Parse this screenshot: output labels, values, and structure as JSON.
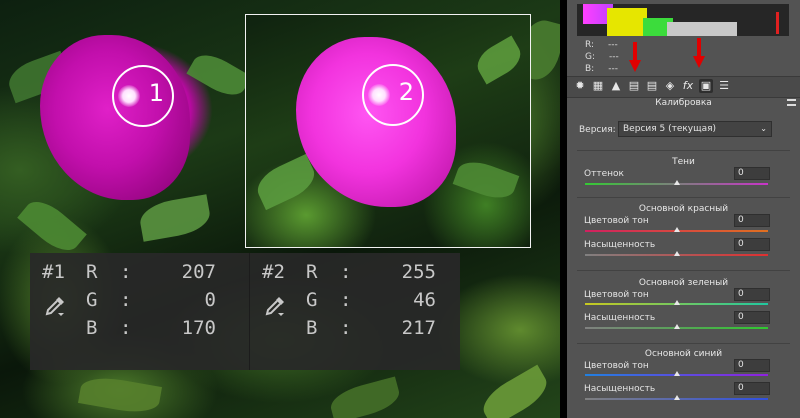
{
  "samples": [
    {
      "id": "#1",
      "channels": [
        {
          "ch": "R",
          "val": "207"
        },
        {
          "ch": "G",
          "val": "0"
        },
        {
          "ch": "B",
          "val": "170"
        }
      ]
    },
    {
      "id": "#2",
      "channels": [
        {
          "ch": "R",
          "val": "255"
        },
        {
          "ch": "G",
          "val": "46"
        },
        {
          "ch": "B",
          "val": "217"
        }
      ]
    }
  ],
  "markers": [
    "1",
    "2"
  ],
  "colon": ":",
  "panel": {
    "readout": [
      {
        "ch": "R:",
        "val": "---"
      },
      {
        "ch": "G:",
        "val": "---"
      },
      {
        "ch": "B:",
        "val": "---"
      }
    ],
    "tools": [
      "aperture-icon",
      "grid-icon",
      "triangle-icon",
      "split-icon",
      "tone-icon",
      "lens-icon",
      "fx",
      "calibration-icon",
      "presets-icon"
    ],
    "tool_fx": "fx",
    "section_title": "Калибровка",
    "version_label": "Версия:",
    "version_value": "Версия 5 (текущая)",
    "groups": [
      {
        "title": "Тени",
        "sliders": [
          {
            "label": "Оттенок",
            "value": "0",
            "track": [
              "#34c934",
              "#c934c9"
            ]
          }
        ]
      },
      {
        "title": "Основной красный",
        "sliders": [
          {
            "label": "Цветовой тон",
            "value": "0",
            "track": [
              "#d02060",
              "#e07020"
            ]
          },
          {
            "label": "Насыщенность",
            "value": "0",
            "track": [
              "#808080",
              "#e03030"
            ]
          }
        ]
      },
      {
        "title": "Основной зеленый",
        "sliders": [
          {
            "label": "Цветовой тон",
            "value": "0",
            "track": [
              "#c8c820",
              "#20c8a0"
            ]
          },
          {
            "label": "Насыщенность",
            "value": "0",
            "track": [
              "#808080",
              "#30c830"
            ]
          }
        ]
      },
      {
        "title": "Основной синий",
        "sliders": [
          {
            "label": "Цветовой тон",
            "value": "0",
            "track": [
              "#2080e0",
              "#9020e0"
            ]
          },
          {
            "label": "Насыщенность",
            "value": "0",
            "track": [
              "#808080",
              "#3050e0"
            ]
          }
        ]
      }
    ]
  },
  "colors": {
    "annotation_arrow": "#e00000",
    "panel_bg": "#535353",
    "info_bg": "#282828"
  }
}
